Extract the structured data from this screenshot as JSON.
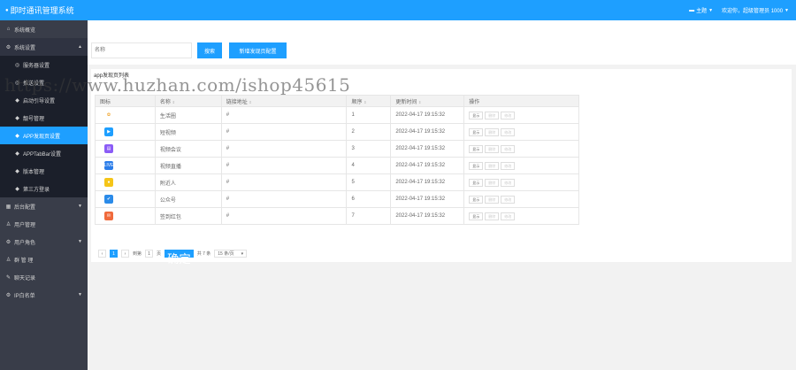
{
  "header": {
    "title": "即时通讯管理系统",
    "theme_label": "主题",
    "welcome_text": "欢迎你，超级管理员 1000",
    "accent_color": "#1e9fff"
  },
  "sidebar": {
    "items": [
      {
        "label": "系统概览",
        "icon": "home-icon"
      },
      {
        "label": "系统设置",
        "icon": "gear-icon"
      },
      {
        "label": "后台配置",
        "icon": "grid-icon"
      },
      {
        "label": "用户管理",
        "icon": "user-icon"
      },
      {
        "label": "用户角色",
        "icon": "gear-icon"
      },
      {
        "label": "群 管 理",
        "icon": "group-icon"
      },
      {
        "label": "聊天记录",
        "icon": "chat-icon"
      },
      {
        "label": "IP白名单",
        "icon": "gear-icon"
      }
    ],
    "subitems": [
      {
        "label": "服务器设置"
      },
      {
        "label": "推送设置"
      },
      {
        "label": "启动引导设置"
      },
      {
        "label": "靓号管理"
      },
      {
        "label": "APP发现页设置"
      },
      {
        "label": "APPTabBar设置"
      },
      {
        "label": "版本管理"
      },
      {
        "label": "第三方登录"
      }
    ]
  },
  "toolbar": {
    "search_placeholder": "名称",
    "search_label": "搜索",
    "add_label": "新增发现页配置"
  },
  "panel": {
    "title": "app发现页列表"
  },
  "table": {
    "headers": [
      "图标",
      "名称",
      "链接地址",
      "顺序",
      "更新时间",
      "操作"
    ],
    "ops": [
      "显示",
      "删除",
      "修改"
    ],
    "rows": [
      {
        "name": "生活圈",
        "link": "#",
        "order": "1",
        "time": "2022-04-17 19:15:32",
        "icon_color": "#ffffff",
        "icon_glyph": "✿"
      },
      {
        "name": "短视频",
        "link": "#",
        "order": "2",
        "time": "2022-04-17 19:15:32",
        "icon_color": "#1e9fff",
        "icon_glyph": "▶"
      },
      {
        "name": "视频会议",
        "link": "#",
        "order": "3",
        "time": "2022-04-17 19:15:32",
        "icon_color": "#8b5cf6",
        "icon_glyph": "▤"
      },
      {
        "name": "视频直播",
        "link": "#",
        "order": "4",
        "time": "2022-04-17 19:15:32",
        "icon_color": "#2b7de9",
        "icon_glyph": "LIVE"
      },
      {
        "name": "附近人",
        "link": "#",
        "order": "5",
        "time": "2022-04-17 19:15:32",
        "icon_color": "#f5c518",
        "icon_glyph": "●"
      },
      {
        "name": "公众号",
        "link": "#",
        "order": "6",
        "time": "2022-04-17 19:15:32",
        "icon_color": "#2b8be9",
        "icon_glyph": "✔"
      },
      {
        "name": "签到红包",
        "link": "#",
        "order": "7",
        "time": "2022-04-17 19:15:32",
        "icon_color": "#f06a3c",
        "icon_glyph": "✉"
      }
    ]
  },
  "pager": {
    "current": "1",
    "goto_label": "到第",
    "page_value": "1",
    "page_unit": "页",
    "confirm_label": "确定",
    "total_label": "共 7 条",
    "page_size_label": "15 条/页"
  },
  "watermark": "https://www.huzhan.com/ishop45615"
}
